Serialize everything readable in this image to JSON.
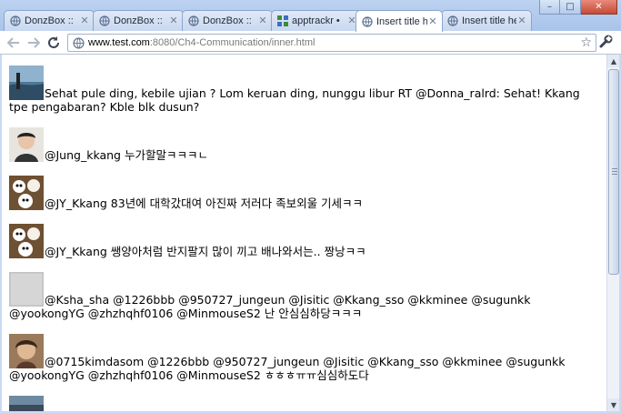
{
  "tabs": [
    {
      "title": "DonzBox ::",
      "icon": "globe-icon",
      "active": false
    },
    {
      "title": "DonzBox ::",
      "icon": "globe-icon",
      "active": false
    },
    {
      "title": "DonzBox ::",
      "icon": "globe-icon",
      "active": false
    },
    {
      "title": "apptrackr •",
      "icon": "apptrackr-icon",
      "active": false
    },
    {
      "title": "Insert title he",
      "icon": "globe-icon",
      "active": true
    },
    {
      "title": "Insert title he",
      "icon": "globe-icon",
      "active": false
    }
  ],
  "window_buttons": {
    "minimize": "–",
    "maximize": "□",
    "close": "✕"
  },
  "toolbar": {
    "back_icon": "back-arrow-icon",
    "forward_icon": "forward-arrow-icon",
    "reload_icon": "reload-icon",
    "url_host": "www.test.com",
    "url_rest": ":8080/Ch4-Communication/inner.html",
    "star_icon": "bookmark-star-icon",
    "wrench_icon": "wrench-icon"
  },
  "feed": [
    {
      "avatar": "seaside",
      "text": "Sehat pule ding, kebile ujian ? Lom keruan ding, nunggu libur RT @Donna_ralrd: Sehat! Kkang tpe pengabaran? Kble blk dusun?"
    },
    {
      "avatar": "portrait-boy",
      "text": "@Jung_kkang 누가할말ㅋㅋㅋㄴ"
    },
    {
      "avatar": "cartoon",
      "text": "@JY_Kkang 83년에 대학갔대여 아진짜 저러다 족보외울 기세ㅋㅋ"
    },
    {
      "avatar": "cartoon",
      "text": "@JY_Kkang 쌩양아처럼 반지팔지 많이 끼고 배나와서는.. 짱낭ㅋㅋ"
    },
    {
      "avatar": "blank",
      "text": "@Ksha_sha @1226bbb @950727_jungeun @Jisitic @Kkang_sso @kkminee @sugunkk @yookongYG @zhzhqhf0106 @MinmouseS2 난 안심심하당ㅋㅋㅋ"
    },
    {
      "avatar": "portrait-girl",
      "text": "@0715kimdasom @1226bbb @950727_jungeun @Jisitic @Kkang_sso @kkminee @sugunkk @yookongYG @zhzhqhf0106 @MinmouseS2 ㅎㅎㅎㅠㅠ심심하도다"
    },
    {
      "avatar": "dark",
      "text": ""
    }
  ],
  "colors": {
    "frame": "#bcd2f0",
    "link_gray": "#7a7a7a"
  }
}
